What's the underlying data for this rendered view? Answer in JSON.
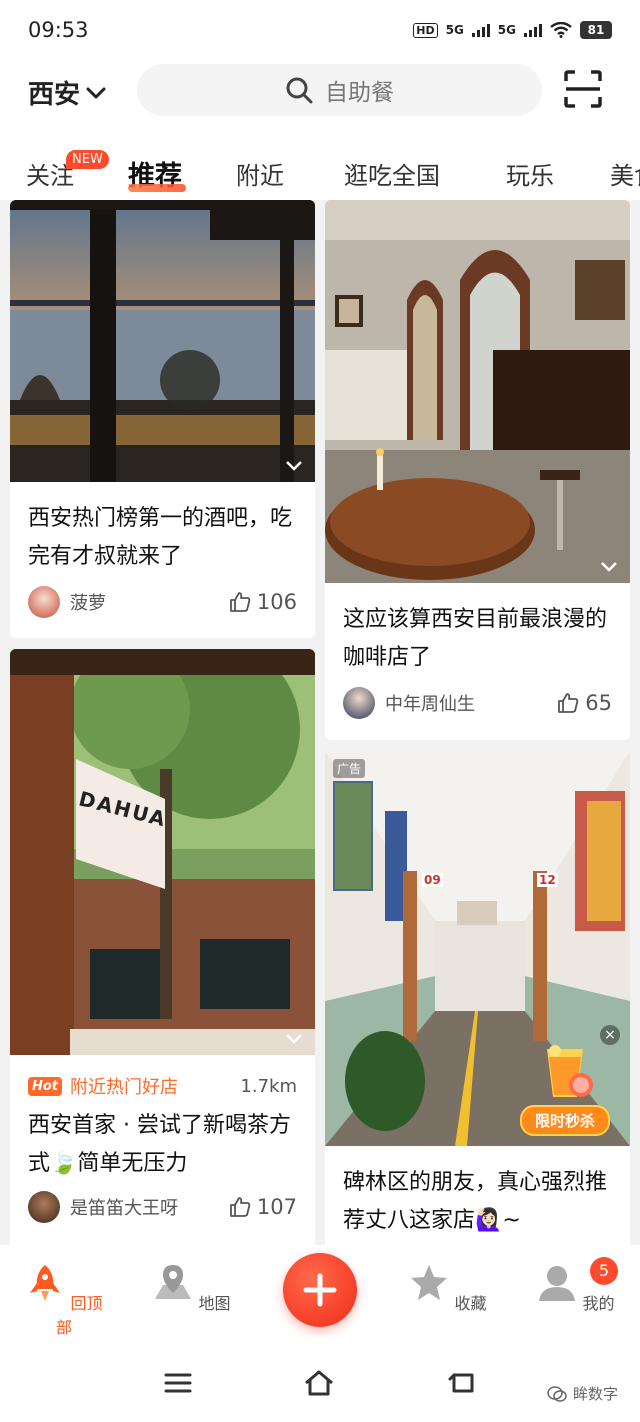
{
  "status": {
    "time": "09:53",
    "hd": "HD",
    "net1": "5G",
    "net2": "5G",
    "battery": "81"
  },
  "header": {
    "city": "西安",
    "search_placeholder": "自助餐"
  },
  "tabs": [
    {
      "label": "关注",
      "badge": "NEW"
    },
    {
      "label": "推荐"
    },
    {
      "label": "附近"
    },
    {
      "label": "逛吃全国"
    },
    {
      "label": "玩乐"
    },
    {
      "label": "美食"
    }
  ],
  "feed": {
    "left": [
      {
        "title": "西安热门榜第一的酒吧，吃完有才叔就来了",
        "user": "菠萝",
        "likes": "106"
      },
      {
        "hot_tag": "Hot",
        "hot_label": "附近热门好店",
        "distance": "1.7km",
        "title": "西安首家 · 尝试了新喝茶方式🍃简单无压力",
        "user": "是笛笛大王呀",
        "likes": "107",
        "sign_text": "DAHUA"
      }
    ],
    "right": [
      {
        "title": "这应该算西安目前最浪漫的咖啡店了",
        "user": "中年周仙生",
        "likes": "65"
      },
      {
        "ad_tag": "广告",
        "promo": "限时秒杀",
        "title": "碑林区的朋友，真心强烈推荐丈八这家店🙋🏻‍♀️~",
        "room1": "09",
        "room2": "12"
      }
    ]
  },
  "bottom_nav": {
    "items": [
      "回顶部",
      "地图",
      "收藏",
      "我的"
    ],
    "badge": "5"
  },
  "watermark": "眸数字",
  "colors": {
    "accent": "#ff5a1f",
    "fab": "#f22a1a"
  }
}
